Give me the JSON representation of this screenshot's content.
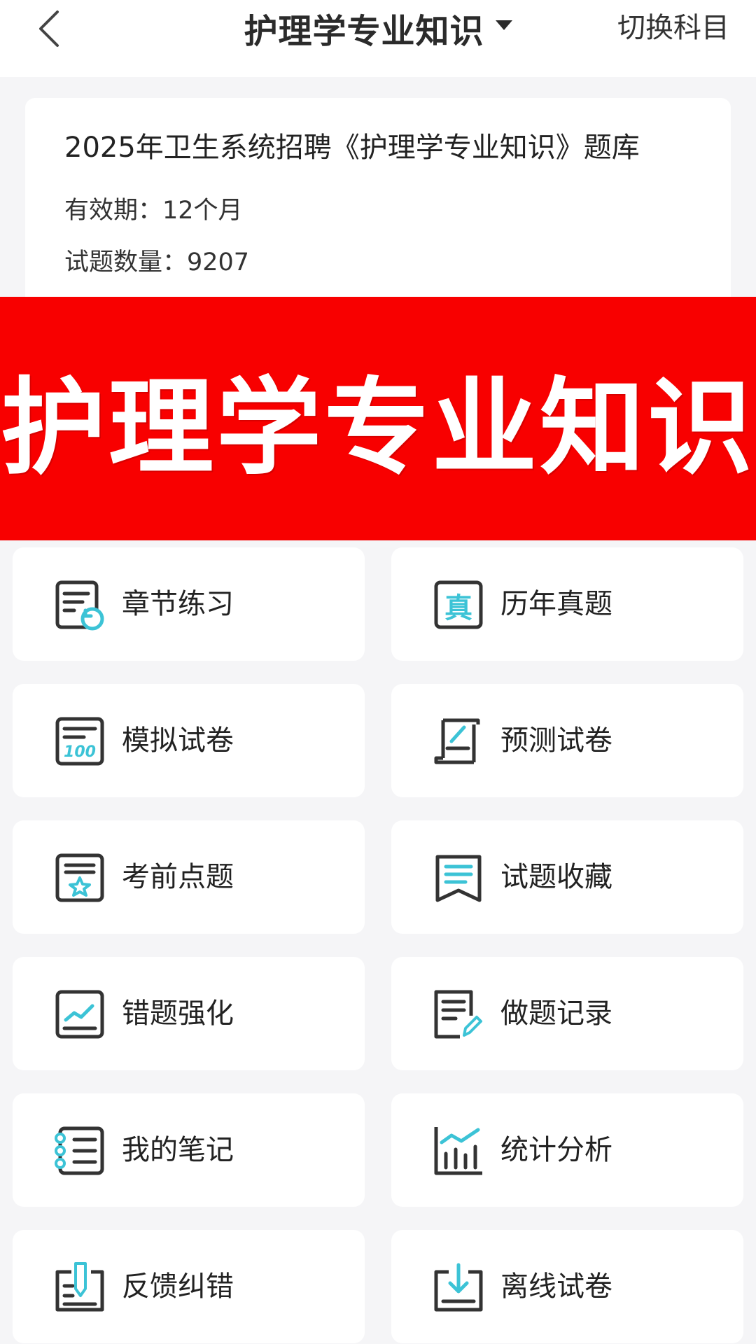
{
  "header": {
    "title": "护理学专业知识",
    "switch_label": "切换科目"
  },
  "info": {
    "title": "2025年卫生系统招聘《护理学专业知识》题库",
    "validity": "有效期：12个月",
    "question_count": "试题数量：9207"
  },
  "banner": {
    "text": "护理学专业知识"
  },
  "menu": {
    "items": [
      {
        "label": "章节练习",
        "icon": "chapter-practice-icon"
      },
      {
        "label": "历年真题",
        "icon": "past-exam-icon"
      },
      {
        "label": "模拟试卷",
        "icon": "mock-paper-icon"
      },
      {
        "label": "预测试卷",
        "icon": "prediction-paper-icon"
      },
      {
        "label": "考前点题",
        "icon": "pre-exam-star-icon"
      },
      {
        "label": "试题收藏",
        "icon": "bookmark-icon"
      },
      {
        "label": "错题强化",
        "icon": "wrong-question-chart-icon"
      },
      {
        "label": "做题记录",
        "icon": "record-edit-icon"
      },
      {
        "label": "我的笔记",
        "icon": "notebook-icon"
      },
      {
        "label": "统计分析",
        "icon": "statistics-icon"
      },
      {
        "label": "反馈纠错",
        "icon": "feedback-pen-icon"
      },
      {
        "label": "离线试卷",
        "icon": "download-icon"
      }
    ]
  },
  "colors": {
    "accent": "#3cc3d6",
    "icon_stroke": "#333333",
    "banner_red": "#f80000"
  }
}
